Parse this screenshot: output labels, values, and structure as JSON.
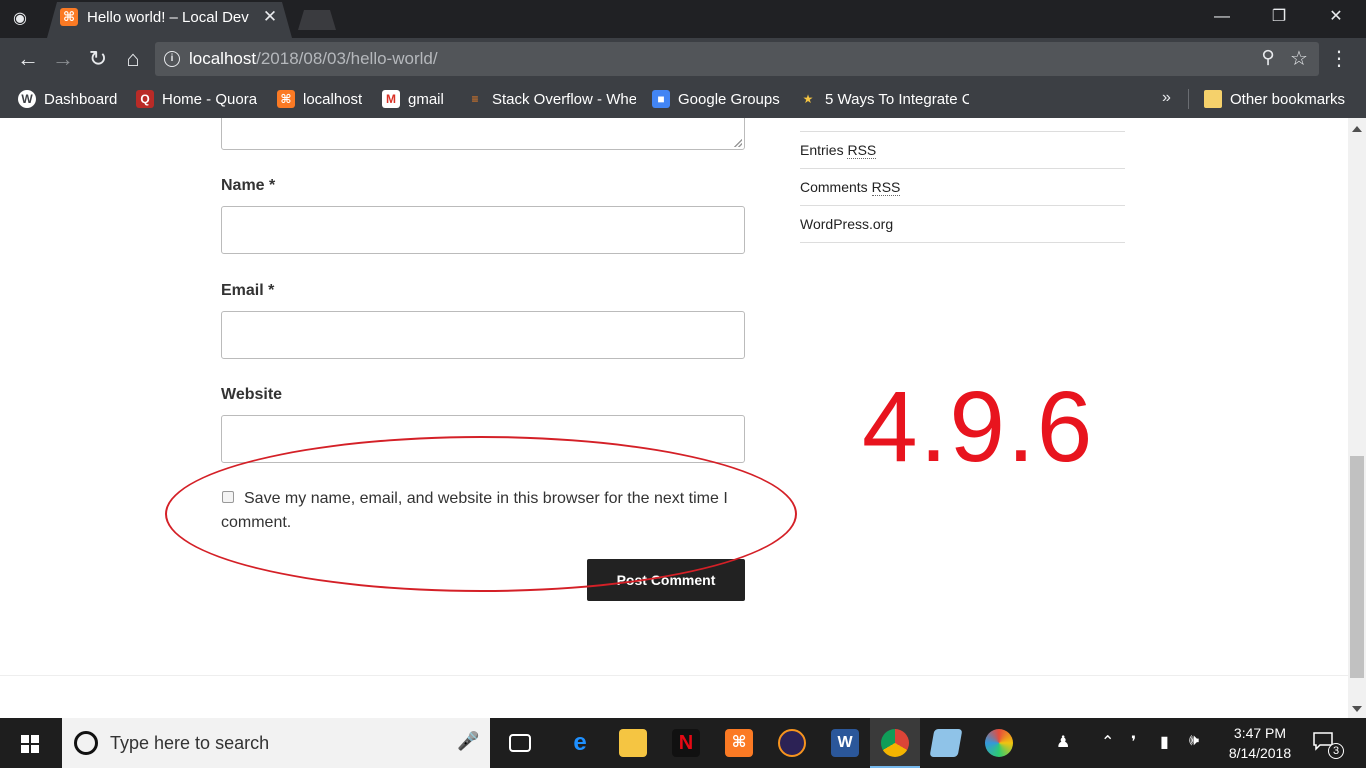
{
  "browser": {
    "tab_title": "Hello world! – Local Dev",
    "url_host": "localhost",
    "url_path": "/2018/08/03/hello-world/",
    "bookmarks": [
      {
        "label": "Dashboard",
        "icon": "wordpress-icon"
      },
      {
        "label": "Home - Quora",
        "icon": "quora-icon"
      },
      {
        "label": "localhost",
        "icon": "xampp-icon"
      },
      {
        "label": "gmail",
        "icon": "gmail-icon"
      },
      {
        "label": "Stack Overflow - Whe",
        "icon": "stackoverflow-icon"
      },
      {
        "label": "Google Groups",
        "icon": "google-groups-icon"
      },
      {
        "label": "5 Ways To Integrate C",
        "icon": "integrate-icon"
      }
    ],
    "other_bookmarks": "Other bookmarks",
    "more_bookmarks": "»"
  },
  "comment_form": {
    "name_label": "Name *",
    "email_label": "Email *",
    "website_label": "Website",
    "consent_text": "Save my name, email, and website in this browser for the next time I comment.",
    "submit_label": "Post Comment"
  },
  "sidebar": {
    "meta_links": [
      {
        "text": "Entries ",
        "abbr": "RSS"
      },
      {
        "text": "Comments ",
        "abbr": "RSS"
      },
      {
        "text": "WordPress.org",
        "abbr": ""
      }
    ]
  },
  "annotation": {
    "version_text": "4.9.6",
    "color": "#e8141e"
  },
  "taskbar": {
    "search_placeholder": "Type here to search",
    "time": "3:47 PM",
    "date": "8/14/2018",
    "notification_count": "3"
  }
}
